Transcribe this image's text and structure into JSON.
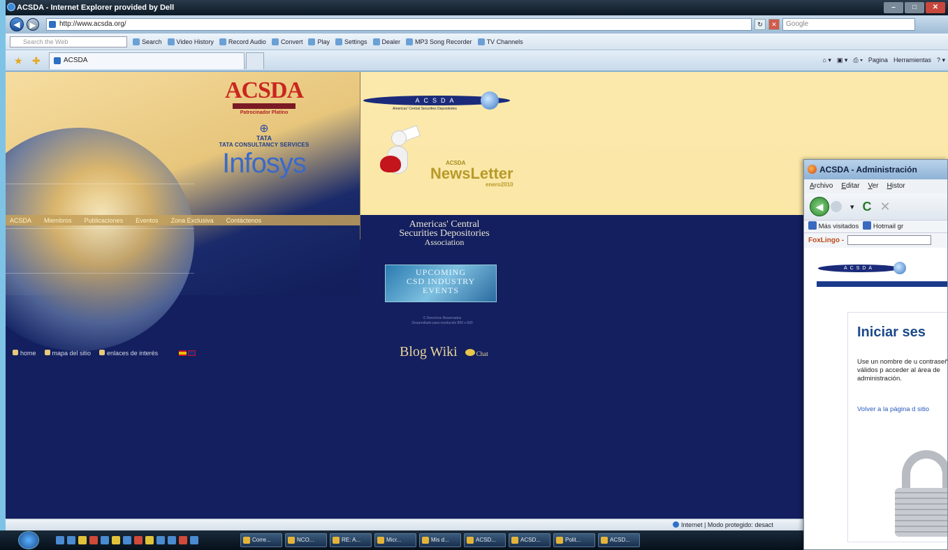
{
  "browser": {
    "title": "ACSDA - Internet Explorer provided by Dell",
    "address": "http://www.acsda.org/",
    "search_placeholder": "Google",
    "toolbar_search_placeholder": "Search the Web",
    "toolbar_items": [
      "Search",
      "Video History",
      "Record Audio",
      "Convert",
      "Play",
      "Settings",
      "Dealer",
      "MP3 Song Recorder",
      "TV Channels"
    ],
    "tab_label": "ACSDA",
    "command_items": [
      "Pagina",
      "Herramientas"
    ],
    "status_text": "Internet | Modo protegido: desact"
  },
  "page": {
    "sponsors": {
      "acsda_logo": "ACSDA",
      "patrocinador": "Patrocinador Platino",
      "tata_mark": "TATA",
      "tata_name": "TATA",
      "tata_cs": "TATA CONSULTANCY SERVICES",
      "infosys": "Infosys"
    },
    "menu": [
      "ACSDA",
      "Miembros",
      "Publicaciones",
      "Eventos",
      "Zona Exclusiva",
      "Contáctenos"
    ],
    "newsletter_banner": "ACSDA",
    "newsletter_banner_sub": "Americas' Central Securities Depositories",
    "newsletter_small": "ACSDA",
    "newsletter_big": "NewsLetter",
    "newsletter_date": "enero2010",
    "association": {
      "line1": "Americas' Central",
      "line2": "Securities Depositories",
      "line3": "Association"
    },
    "upcoming": {
      "line1": "UPCOMING",
      "line2": "CSD INDUSTRY",
      "line3": "EVENTS"
    },
    "copyright_line1": "© Derechos Reservados",
    "copyright_line2": "Desarrollado para resolución 800 x 600",
    "bottom_links": {
      "home": "home",
      "sitemap": "mapa del sitio",
      "links": "enlaces de interés"
    },
    "blog": "Blog",
    "wiki": "Wiki",
    "chat": "Chat"
  },
  "taskbar": {
    "items": [
      "Corre...",
      "NCO...",
      "RE: A...",
      "Micr...",
      "Mis d...",
      "ACSD...",
      "ACSD...",
      "Polit...",
      "ACSD..."
    ]
  },
  "popup": {
    "title": "ACSDA - Administración",
    "menu": [
      "Archivo",
      "Editar",
      "Ver",
      "Histor"
    ],
    "bookmarks": [
      "Más visitados",
      "Hotmail gr"
    ],
    "foxlingo": "FoxLingo -",
    "banner": "ACSDA",
    "heading": "Iniciar ses",
    "description": "Use un nombre de u contraseña válidos p acceder al área de administración.",
    "back_link": "Volver a la página d sitio"
  }
}
